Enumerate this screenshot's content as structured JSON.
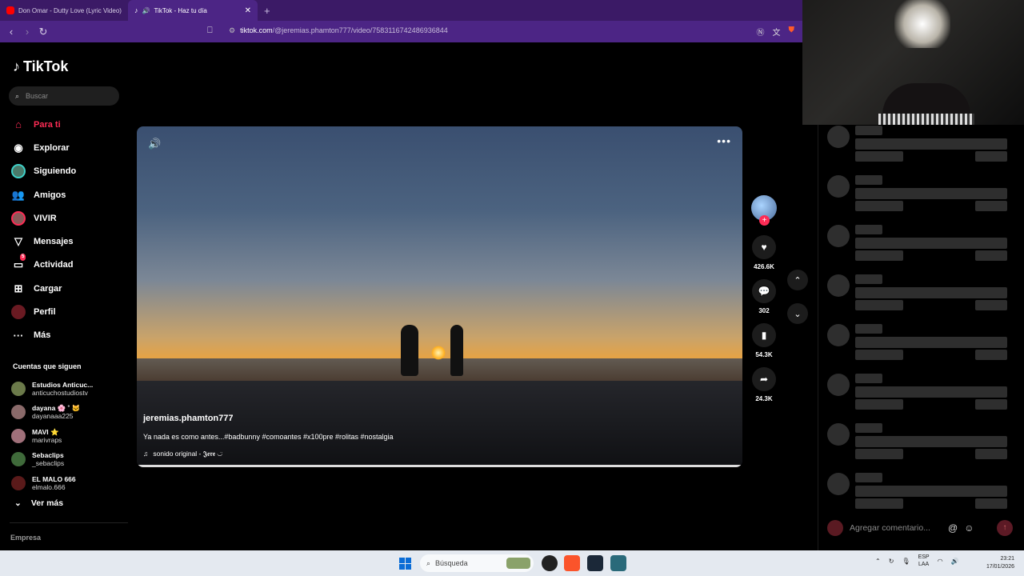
{
  "browser": {
    "tabs": [
      {
        "label": "Don Omar - Dutty Love (Lyric Video)",
        "color": "#ff0000",
        "active": false
      },
      {
        "label": "TikTok - Haz tu día",
        "color": "#111111",
        "active": true
      }
    ],
    "url_host": "tiktok.com",
    "url_path": "/@jeremias.phamton777/video/7583116742486936844"
  },
  "tiktok": {
    "logo": "TikTok",
    "search_placeholder": "Buscar",
    "nav": [
      {
        "label": "Para ti",
        "icon": "home-icon"
      },
      {
        "label": "Explorar",
        "icon": "compass-icon"
      },
      {
        "label": "Siguiendo",
        "icon": "following-avatar-icon"
      },
      {
        "label": "Amigos",
        "icon": "friends-icon"
      },
      {
        "label": "VIVIR",
        "icon": "live-icon"
      },
      {
        "label": "Mensajes",
        "icon": "messages-icon"
      },
      {
        "label": "Actividad",
        "icon": "activity-icon"
      },
      {
        "label": "Cargar",
        "icon": "upload-icon"
      },
      {
        "label": "Perfil",
        "icon": "profile-icon"
      },
      {
        "label": "Más",
        "icon": "more-icon"
      }
    ],
    "activity_badge": "5",
    "following_title": "Cuentas que siguen",
    "following": [
      {
        "name": "Estudios Anticuc...",
        "user": "anticuchostudiostv",
        "color": "#6b7a4a"
      },
      {
        "name": "dayana 🌸 ˚ 🐱",
        "user": "dayanaaa225",
        "color": "#8a6a6a"
      },
      {
        "name": "MAVI ⭐",
        "user": "marivraps",
        "color": "#a0707a"
      },
      {
        "name": "Sebaclips",
        "user": "_sebaclips",
        "color": "#3f6a3a"
      },
      {
        "name": "EL MALO 666",
        "user": "elmalo.666",
        "color": "#5a1a1a"
      }
    ],
    "see_more": "Ver más",
    "empresa": "Empresa"
  },
  "video": {
    "username": "jeremias.phamton777",
    "description": "Ya nada es como antes...#badbunny #comoantes #x100pre #rolitas #nostalgia",
    "sound": "sonido original - 𝕵𝖊𝖗𝖊 ◡̈",
    "progress": 1.0,
    "likes": "426.6K",
    "comments": "302",
    "saves": "54.3K",
    "shares": "24.3K"
  },
  "comments_panel": {
    "placeholder": "Agregar comentario...",
    "skeleton_rows": 8
  },
  "taskbar": {
    "search_placeholder": "Búsqueda",
    "lang_top": "ESP",
    "lang_bottom": "LAA",
    "time": "23:21",
    "date": "17/01/2026"
  }
}
